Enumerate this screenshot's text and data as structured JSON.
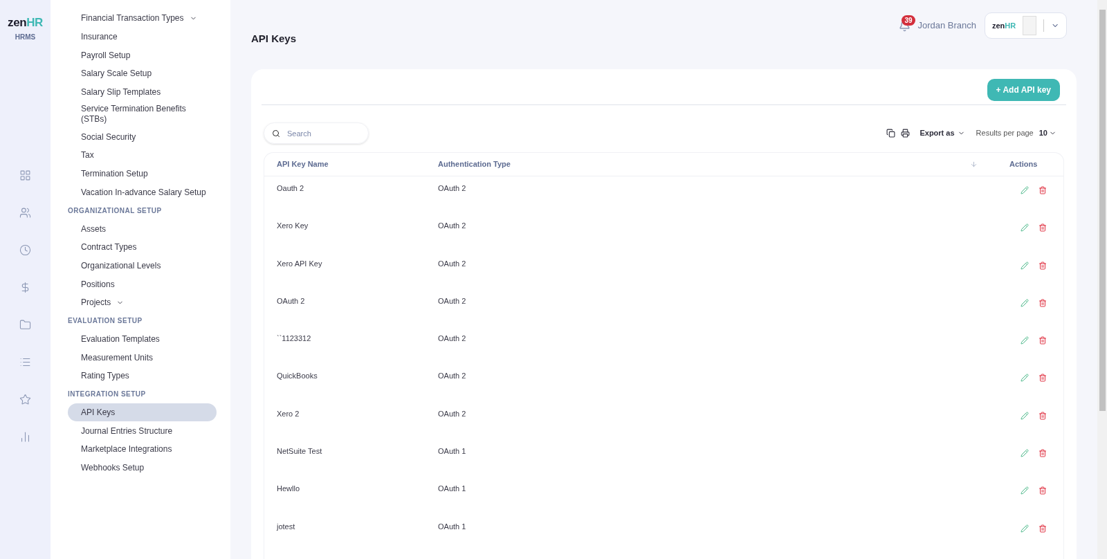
{
  "brand": {
    "logo_left": "zen",
    "logo_right": "HR",
    "subtitle": "HRMS"
  },
  "rail": [
    {
      "selected": false
    },
    {
      "selected": false
    },
    {
      "selected": false
    },
    {
      "selected": false
    },
    {
      "selected": false
    },
    {
      "selected": false
    },
    {
      "selected": false
    },
    {
      "selected": false
    }
  ],
  "sidebar": [
    {
      "kind": "item",
      "label": "Financial Transaction Types",
      "selected": false,
      "expandable": true
    },
    {
      "kind": "item",
      "label": "Insurance",
      "selected": false,
      "expandable": false
    },
    {
      "kind": "item",
      "label": "Payroll Setup",
      "selected": false,
      "expandable": false
    },
    {
      "kind": "item",
      "label": "Salary Scale Setup",
      "selected": false,
      "expandable": false
    },
    {
      "kind": "item",
      "label": "Salary Slip Templates",
      "selected": false,
      "expandable": false
    },
    {
      "kind": "item",
      "label": "Service Termination Benefits (STBs)",
      "selected": false,
      "expandable": false
    },
    {
      "kind": "item",
      "label": "Social Security",
      "selected": false,
      "expandable": false
    },
    {
      "kind": "item",
      "label": "Tax",
      "selected": false,
      "expandable": false
    },
    {
      "kind": "item",
      "label": "Termination Setup",
      "selected": false,
      "expandable": false
    },
    {
      "kind": "item",
      "label": "Vacation In-advance Salary Setup",
      "selected": false,
      "expandable": false
    },
    {
      "kind": "heading",
      "label": "ORGANIZATIONAL SETUP"
    },
    {
      "kind": "item",
      "label": "Assets",
      "selected": false,
      "expandable": false
    },
    {
      "kind": "item",
      "label": "Contract Types",
      "selected": false,
      "expandable": false
    },
    {
      "kind": "item",
      "label": "Organizational Levels",
      "selected": false,
      "expandable": false
    },
    {
      "kind": "item",
      "label": "Positions",
      "selected": false,
      "expandable": false
    },
    {
      "kind": "item",
      "label": "Projects",
      "selected": false,
      "expandable": true
    },
    {
      "kind": "heading",
      "label": "EVALUATION SETUP"
    },
    {
      "kind": "item",
      "label": "Evaluation Templates",
      "selected": false,
      "expandable": false
    },
    {
      "kind": "item",
      "label": "Measurement Units",
      "selected": false,
      "expandable": false
    },
    {
      "kind": "item",
      "label": "Rating Types",
      "selected": false,
      "expandable": false
    },
    {
      "kind": "heading",
      "label": "INTEGRATION SETUP"
    },
    {
      "kind": "item",
      "label": "API Keys",
      "selected": true,
      "expandable": false
    },
    {
      "kind": "item",
      "label": "Journal Entries Structure",
      "selected": false,
      "expandable": false
    },
    {
      "kind": "item",
      "label": "Marketplace Integrations",
      "selected": false,
      "expandable": false
    },
    {
      "kind": "item",
      "label": "Webhooks Setup",
      "selected": false,
      "expandable": false
    }
  ],
  "header": {
    "title": "API Keys",
    "notifications": "39",
    "user": "Jordan Branch",
    "company_logo_left": "zen",
    "company_logo_right": "HR"
  },
  "toolbar": {
    "add_button": "+ Add API key",
    "search_placeholder": "Search",
    "export": "Export as",
    "results_label": "Results per page",
    "results_value": "10"
  },
  "table": {
    "columns": [
      "API Key Name",
      "Authentication Type",
      "Actions"
    ],
    "rows": [
      {
        "name": "Oauth 2",
        "auth": "OAuth 2"
      },
      {
        "name": "Xero Key",
        "auth": "OAuth 2"
      },
      {
        "name": "Xero API Key",
        "auth": "OAuth 2"
      },
      {
        "name": "OAuth 2",
        "auth": "OAuth 2"
      },
      {
        "name": "``1123312",
        "auth": "OAuth 2"
      },
      {
        "name": "QuickBooks",
        "auth": "OAuth 2"
      },
      {
        "name": "Xero 2",
        "auth": "OAuth 2"
      },
      {
        "name": "NetSuite Test",
        "auth": "OAuth 1"
      },
      {
        "name": "Hewllo",
        "auth": "OAuth 1"
      },
      {
        "name": "jotest",
        "auth": "OAuth 1"
      }
    ]
  }
}
